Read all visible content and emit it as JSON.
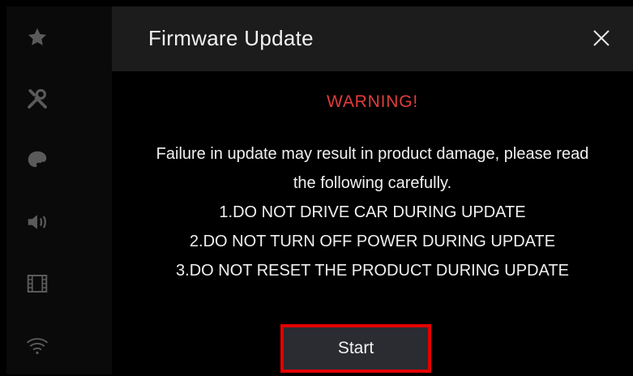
{
  "sidebar": {
    "items": [
      {
        "icon": "star-icon"
      },
      {
        "icon": "tools-icon"
      },
      {
        "icon": "palette-icon"
      },
      {
        "icon": "speaker-icon"
      },
      {
        "icon": "film-icon"
      },
      {
        "icon": "wifi-icon"
      }
    ]
  },
  "header": {
    "title": "Firmware Update",
    "close_icon": "close-icon"
  },
  "dialog": {
    "warning": "WARNING!",
    "lines": [
      "Failure in update may result in product damage, please read",
      "the following carefully.",
      "1.DO NOT DRIVE CAR DURING UPDATE",
      "2.DO NOT TURN OFF POWER DURING UPDATE",
      "3.DO NOT RESET THE PRODUCT DURING UPDATE"
    ],
    "start_label": "Start"
  },
  "colors": {
    "warning": "#e03c3c",
    "highlight": "#e30000",
    "header_bg": "#1c1c1c",
    "button_bg": "#2a2c31"
  }
}
